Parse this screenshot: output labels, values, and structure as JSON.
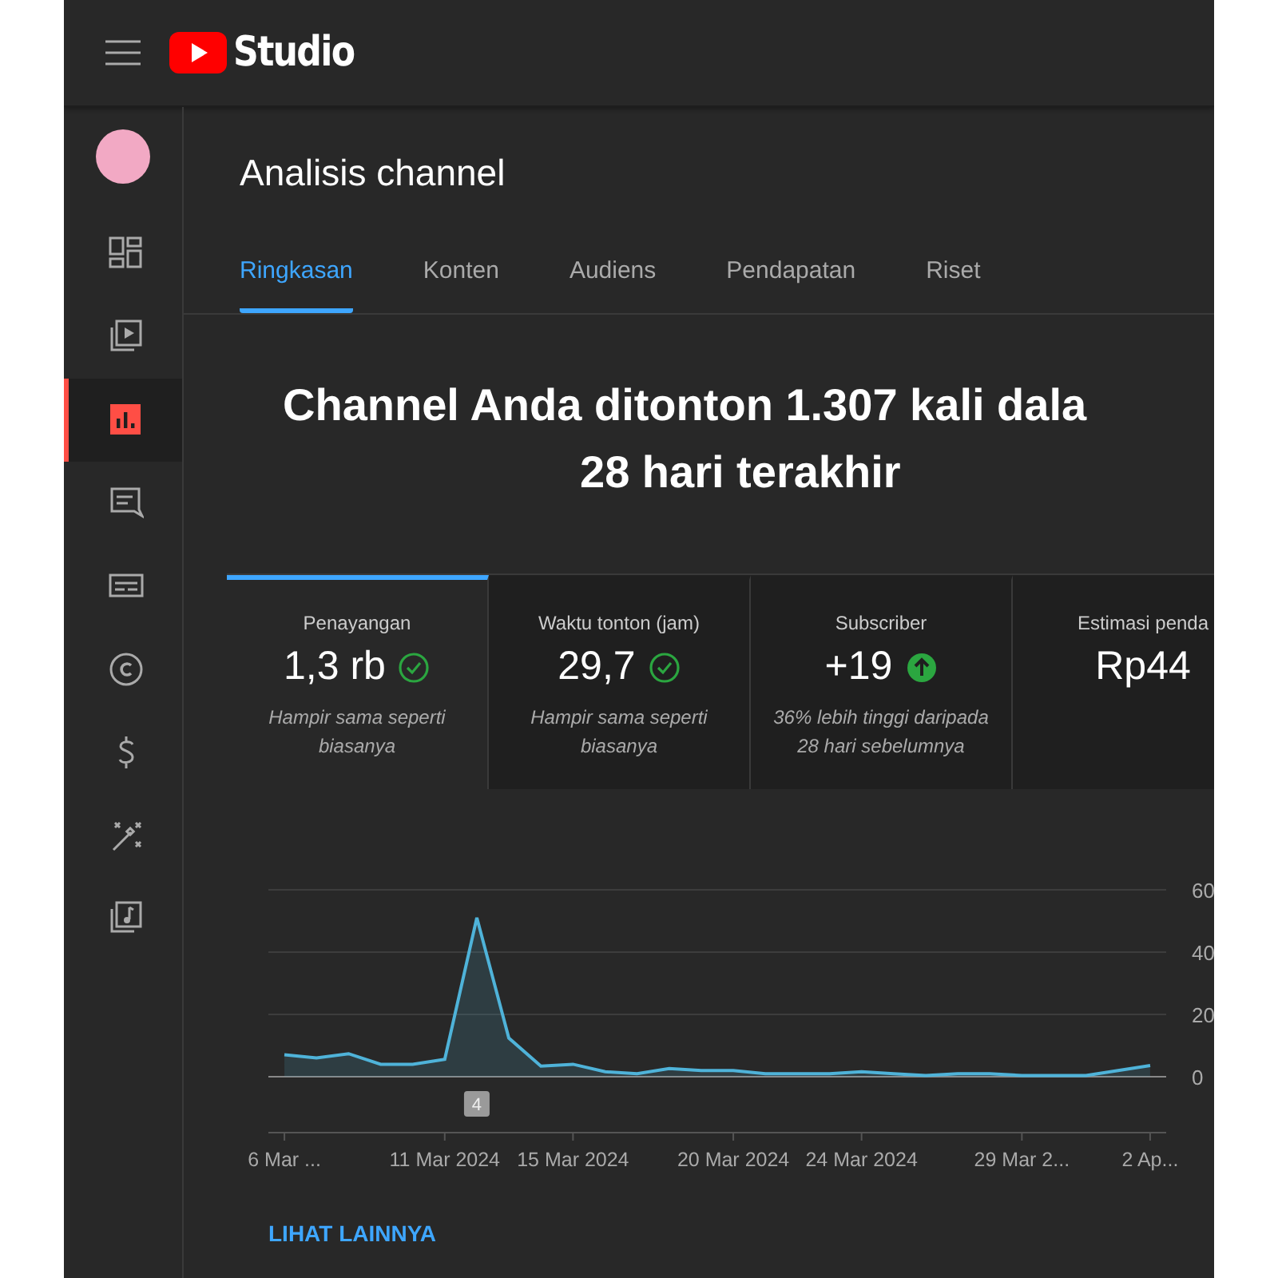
{
  "topbar": {
    "logo_text": "Studio"
  },
  "sidebar": {
    "items": [
      {
        "kind": "dashboard",
        "selected": false
      },
      {
        "kind": "content",
        "selected": false
      },
      {
        "kind": "analytics",
        "selected": true
      },
      {
        "kind": "comments",
        "selected": false
      },
      {
        "kind": "subtitles",
        "selected": false
      },
      {
        "kind": "copyright",
        "selected": false
      },
      {
        "kind": "earn",
        "selected": false
      },
      {
        "kind": "customization",
        "selected": false
      },
      {
        "kind": "audio",
        "selected": false
      }
    ]
  },
  "page_title": "Analisis channel",
  "tabs": [
    {
      "label": "Ringkasan",
      "selected": true
    },
    {
      "label": "Konten",
      "selected": false
    },
    {
      "label": "Audiens",
      "selected": false
    },
    {
      "label": "Pendapatan",
      "selected": false
    },
    {
      "label": "Riset",
      "selected": false
    }
  ],
  "headline_lines": [
    "Channel Anda ditonton 1.307 kali dala",
    "28 hari terakhir"
  ],
  "metrics": [
    {
      "label": "Penayangan",
      "value": "1,3 rb",
      "kind": "check",
      "note": "Hampir sama seperti biasanya",
      "selected": true
    },
    {
      "label": "Waktu tonton (jam)",
      "value": "29,7",
      "kind": "check",
      "note": "Hampir sama seperti biasanya",
      "selected": false
    },
    {
      "label": "Subscriber",
      "value": "+19",
      "kind": "up",
      "note": "36% lebih tinggi daripada 28 hari sebelumnya",
      "selected": false
    },
    {
      "label": "Estimasi penda",
      "value": "Rp44",
      "kind": "plain",
      "selected": false
    }
  ],
  "chart": {
    "chart_data": {
      "type": "area",
      "categories": [
        "6 Mar ...",
        null,
        null,
        null,
        null,
        "11 Mar 2024",
        null,
        null,
        null,
        "15 Mar 2024",
        null,
        null,
        null,
        null,
        "20 Mar 2024",
        null,
        null,
        null,
        "24 Mar 2024",
        null,
        null,
        null,
        null,
        "29 Mar 2...",
        null,
        null,
        null,
        "2 Ap..."
      ],
      "series": [
        {
          "color": "#4fb3d9",
          "values": [
            7,
            6,
            7.4,
            4,
            4,
            5.6,
            51,
            12.4,
            3.4,
            4,
            1.6,
            1,
            2.6,
            2,
            2,
            1,
            1,
            1,
            1.6,
            1,
            0.4,
            1,
            1,
            0.4,
            0.4,
            0.4,
            2,
            3.6
          ]
        }
      ],
      "yticks": [
        0,
        20,
        40,
        60
      ],
      "ylim": [
        0,
        60
      ],
      "annotations": [
        "4"
      ]
    }
  },
  "see_more_link": "LIHAT LAINNYA"
}
